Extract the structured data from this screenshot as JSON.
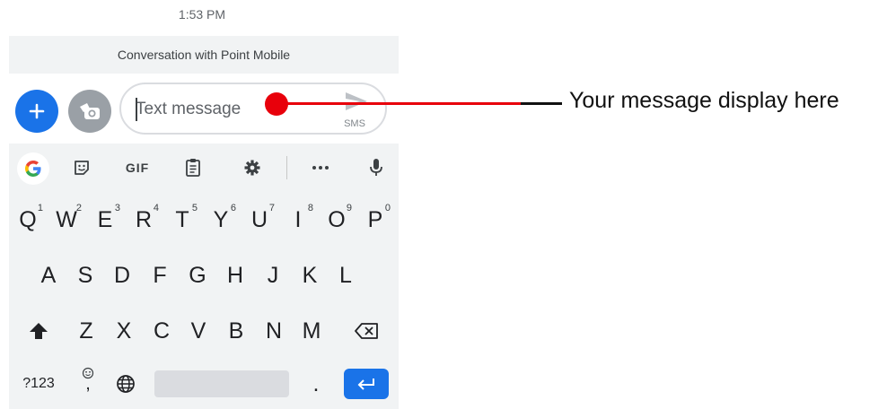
{
  "status": {
    "time": "1:53 PM"
  },
  "conversation": {
    "title": "Conversation with Point Mobile"
  },
  "compose": {
    "placeholder": "Text message",
    "send_mode": "SMS"
  },
  "annotation": {
    "text": "Your message display here"
  },
  "keyboard": {
    "toolbar": [
      "google-icon",
      "sticker-icon",
      "GIF",
      "clipboard-icon",
      "gear-icon",
      "more-icon",
      "mic-icon"
    ],
    "toolbar_gif": "GIF",
    "row1": [
      {
        "label": "Q",
        "hint": "1"
      },
      {
        "label": "W",
        "hint": "2"
      },
      {
        "label": "E",
        "hint": "3"
      },
      {
        "label": "R",
        "hint": "4"
      },
      {
        "label": "T",
        "hint": "5"
      },
      {
        "label": "Y",
        "hint": "6"
      },
      {
        "label": "U",
        "hint": "7"
      },
      {
        "label": "I",
        "hint": "8"
      },
      {
        "label": "O",
        "hint": "9"
      },
      {
        "label": "P",
        "hint": "0"
      }
    ],
    "row2": [
      "A",
      "S",
      "D",
      "F",
      "G",
      "H",
      "J",
      "K",
      "L"
    ],
    "row3": [
      "Z",
      "X",
      "C",
      "V",
      "B",
      "N",
      "M"
    ],
    "bottom": {
      "symbols": "?123",
      "comma": ",",
      "period": "."
    }
  },
  "colors": {
    "accent": "#1a73e8",
    "annotation": "#e8000b"
  }
}
